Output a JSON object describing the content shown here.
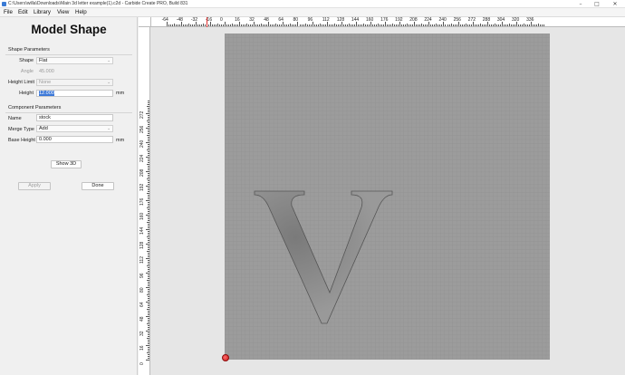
{
  "window": {
    "title": "C:\\Users\\willa\\Downloads\\Main 3d letter example(1).c2d - Carbide Create PRO, Build 831",
    "minimize_glyph": "–",
    "maximize_glyph": "□",
    "close_glyph": "✕"
  },
  "menu": {
    "items": [
      {
        "label": "File"
      },
      {
        "label": "Edit"
      },
      {
        "label": "Library"
      },
      {
        "label": "View"
      },
      {
        "label": "Help"
      }
    ]
  },
  "panel": {
    "title": "Model Shape",
    "shape_params": {
      "header": "Shape Parameters",
      "shape_label": "Shape",
      "shape_value": "Flat",
      "angle_label": "Angle",
      "angle_value": "45.000",
      "height_limit_label": "Height Limit",
      "height_limit_value": "None",
      "height_label": "Height",
      "height_value": "12.000",
      "height_unit": "mm"
    },
    "component_params": {
      "header": "Component Parameters",
      "name_label": "Name",
      "name_value": "stock",
      "merge_label": "Merge Type",
      "merge_value": "Add",
      "base_height_label": "Base Height",
      "base_height_value": "0.000",
      "base_height_unit": "mm"
    },
    "buttons": {
      "show3d": "Show 3D",
      "apply": "Apply",
      "done": "Done"
    },
    "dropdown_arrow": "⌄"
  },
  "rulers": {
    "horizontal": [
      "-64",
      "-48",
      "-32",
      "-16",
      "0",
      "16",
      "32",
      "48",
      "64",
      "80",
      "96",
      "112",
      "128",
      "144",
      "160",
      "176",
      "192",
      "208",
      "224",
      "240",
      "256",
      "272",
      "288",
      "304",
      "320",
      "336"
    ],
    "vertical": [
      "272",
      "256",
      "240",
      "224",
      "208",
      "192",
      "176",
      "160",
      "144",
      "128",
      "112",
      "96",
      "80",
      "64",
      "48",
      "32",
      "16",
      "0"
    ]
  },
  "canvas": {
    "stock_color": "#9c9c9c",
    "grid_color": "#8a8a8a",
    "letter": "V"
  }
}
